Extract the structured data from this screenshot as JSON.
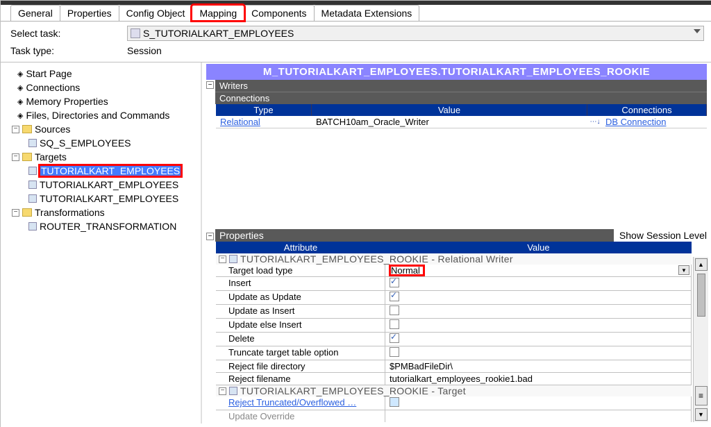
{
  "tabs": {
    "general": "General",
    "properties": "Properties",
    "config_object": "Config Object",
    "mapping": "Mapping",
    "components": "Components",
    "metadata_extensions": "Metadata Extensions"
  },
  "form": {
    "select_task_label": "Select task:",
    "select_task_value": "S_TUTORIALKART_EMPLOYEES",
    "task_type_label": "Task type:",
    "task_type_value": "Session"
  },
  "tree": {
    "start_page": "Start Page",
    "connections": "Connections",
    "memory_properties": "Memory Properties",
    "files_dirs": "Files, Directories and Commands",
    "sources": "Sources",
    "sq_s_employees": "SQ_S_EMPLOYEES",
    "targets": "Targets",
    "target1": "TUTORIALKART_EMPLOYEES",
    "target2": "TUTORIALKART_EMPLOYEES",
    "target3": "TUTORIALKART_EMPLOYEES",
    "transformations": "Transformations",
    "router": "ROUTER_TRANSFORMATION"
  },
  "detail": {
    "mapping_title": "M_TUTORIALKART_EMPLOYEES.TUTORIALKART_EMPLOYEES_ROOKIE",
    "writers_label": "Writers",
    "connections_label": "Connections",
    "col_type": "Type",
    "col_value": "Value",
    "col_connections": "Connections",
    "row_type": "Relational",
    "row_value": "BATCH10am_Oracle_Writer",
    "row_conn": "DB Connection",
    "properties_label": "Properties",
    "show_session": "Show Session Level",
    "attr_header": "Attribute",
    "value_header": "Value",
    "section1": "TUTORIALKART_EMPLOYEES_ROOKIE - Relational Writer",
    "rows": {
      "target_load_type": {
        "a": "Target load type",
        "v": "Normal"
      },
      "insert": {
        "a": "Insert"
      },
      "update_as_update": {
        "a": "Update as Update"
      },
      "update_as_insert": {
        "a": "Update as Insert"
      },
      "update_else_insert": {
        "a": "Update else Insert"
      },
      "delete": {
        "a": "Delete"
      },
      "truncate": {
        "a": "Truncate target table option"
      },
      "reject_dir": {
        "a": "Reject file directory",
        "v": "$PMBadFileDir\\"
      },
      "reject_file": {
        "a": "Reject filename",
        "v": "tutorialkart_employees_rookie1.bad"
      }
    },
    "section2": "TUTORIALKART_EMPLOYEES_ROOKIE - Target",
    "reject_trunc": "Reject Truncated/Overflowed …",
    "update_override": "Update Override"
  }
}
